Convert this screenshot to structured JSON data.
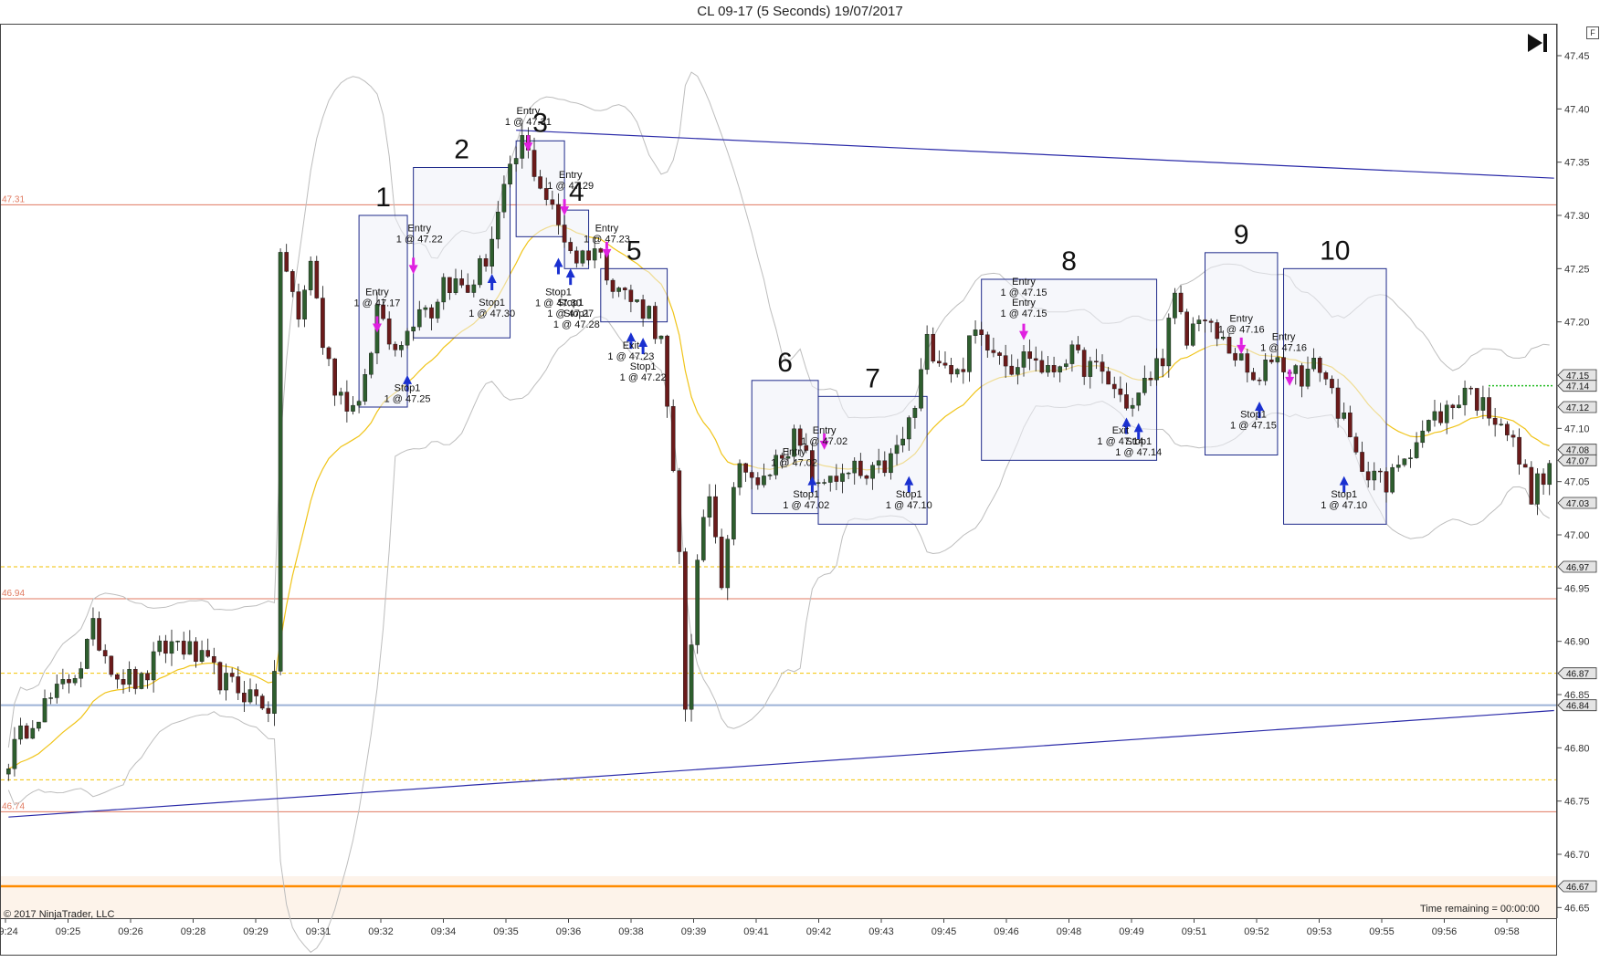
{
  "title": "CL 09-17 (5 Seconds)  19/07/2017",
  "copyright": "© 2017 NinjaTrader, LLC",
  "time_remaining": "Time remaining = 00:00:00",
  "corner_button": "F",
  "play_icon": "skip-to-end-icon",
  "colors": {
    "up_bar": "#2e5e2e",
    "down_bar": "#6b1a1a",
    "bollinger": "#bdbdbd",
    "ema": "#f0c419",
    "trendline": "#2a2aa8",
    "level_red": "#e07a60",
    "level_yellow": "#f2c200",
    "level_orange": "#ff8c00",
    "level_blue": "#9db2d6",
    "box_border": "#1e2a8a",
    "entry_arrow": "#e020e0",
    "exit_arrow": "#1a30d0"
  },
  "chart_data": {
    "type": "candlestick",
    "x_ticks": [
      "09:24",
      "09:25",
      "09:26",
      "09:28",
      "09:29",
      "09:31",
      "09:32",
      "09:34",
      "09:35",
      "09:36",
      "09:38",
      "09:39",
      "09:41",
      "09:42",
      "09:43",
      "09:45",
      "09:46",
      "09:48",
      "09:49",
      "09:51",
      "09:52",
      "09:53",
      "09:55",
      "09:56",
      "09:58"
    ],
    "y_ticks": [
      "46.65",
      "46.70",
      "46.75",
      "46.80",
      "46.85",
      "46.90",
      "46.95",
      "47.00",
      "47.05",
      "47.10",
      "47.15",
      "47.20",
      "47.25",
      "47.30",
      "47.35",
      "47.40",
      "47.45"
    ],
    "ylim": [
      46.64,
      47.48
    ],
    "left_level_labels": [
      "47.31",
      "46.94",
      "46.74"
    ],
    "right_price_tags": [
      "47.15",
      "47.14",
      "47.12",
      "47.08",
      "47.07",
      "47.03",
      "46.97",
      "46.87",
      "46.84",
      "46.67"
    ],
    "horizontal_levels": [
      {
        "price": 47.31,
        "style": "red"
      },
      {
        "price": 46.94,
        "style": "red"
      },
      {
        "price": 46.74,
        "style": "red"
      },
      {
        "price": 46.97,
        "style": "yellow-dash"
      },
      {
        "price": 46.87,
        "style": "yellow-dash"
      },
      {
        "price": 46.77,
        "style": "yellow-dash"
      },
      {
        "price": 46.84,
        "style": "blue"
      },
      {
        "price": 46.67,
        "style": "orange"
      }
    ],
    "trendlines": [
      {
        "t1": 84,
        "p1": 47.38,
        "t2": 255,
        "p2": 47.335
      },
      {
        "t1": 0,
        "p1": 46.735,
        "t2": 255,
        "p2": 46.835
      }
    ],
    "path_anchors": [
      [
        0,
        46.79
      ],
      [
        4,
        46.83
      ],
      [
        8,
        46.85
      ],
      [
        12,
        46.88
      ],
      [
        14,
        46.91
      ],
      [
        18,
        46.87
      ],
      [
        22,
        46.86
      ],
      [
        25,
        46.89
      ],
      [
        28,
        46.9
      ],
      [
        32,
        46.88
      ],
      [
        36,
        46.86
      ],
      [
        40,
        46.85
      ],
      [
        43,
        46.84
      ],
      [
        44,
        46.86
      ],
      [
        45,
        47.27
      ],
      [
        48,
        47.2
      ],
      [
        50,
        47.26
      ],
      [
        52,
        47.18
      ],
      [
        54,
        47.14
      ],
      [
        57,
        47.12
      ],
      [
        60,
        47.16
      ],
      [
        61,
        47.22
      ],
      [
        63,
        47.18
      ],
      [
        66,
        47.19
      ],
      [
        68,
        47.22
      ],
      [
        70,
        47.21
      ],
      [
        72,
        47.24
      ],
      [
        76,
        47.23
      ],
      [
        79,
        47.26
      ],
      [
        82,
        47.32
      ],
      [
        85,
        47.37
      ],
      [
        88,
        47.33
      ],
      [
        91,
        47.29
      ],
      [
        94,
        47.26
      ],
      [
        97,
        47.27
      ],
      [
        100,
        47.24
      ],
      [
        103,
        47.22
      ],
      [
        106,
        47.21
      ],
      [
        108,
        47.18
      ],
      [
        110,
        47.05
      ],
      [
        111,
        46.98
      ],
      [
        112,
        46.84
      ],
      [
        114,
        46.97
      ],
      [
        116,
        47.04
      ],
      [
        118,
        46.96
      ],
      [
        120,
        47.05
      ],
      [
        122,
        47.07
      ],
      [
        124,
        47.04
      ],
      [
        126,
        47.06
      ],
      [
        128,
        47.08
      ],
      [
        130,
        47.09
      ],
      [
        132,
        47.07
      ],
      [
        134,
        47.04
      ],
      [
        136,
        47.06
      ],
      [
        138,
        47.05
      ],
      [
        140,
        47.06
      ],
      [
        142,
        47.05
      ],
      [
        144,
        47.06
      ],
      [
        146,
        47.07
      ],
      [
        148,
        47.09
      ],
      [
        150,
        47.12
      ],
      [
        152,
        47.18
      ],
      [
        154,
        47.17
      ],
      [
        157,
        47.15
      ],
      [
        160,
        47.19
      ],
      [
        163,
        47.18
      ],
      [
        166,
        47.16
      ],
      [
        169,
        47.17
      ],
      [
        172,
        47.15
      ],
      [
        175,
        47.17
      ],
      [
        178,
        47.16
      ],
      [
        181,
        47.15
      ],
      [
        184,
        47.13
      ],
      [
        186,
        47.12
      ],
      [
        188,
        47.14
      ],
      [
        191,
        47.17
      ],
      [
        193,
        47.22
      ],
      [
        195,
        47.18
      ],
      [
        197,
        47.21
      ],
      [
        199,
        47.19
      ],
      [
        201,
        47.18
      ],
      [
        203,
        47.17
      ],
      [
        205,
        47.15
      ],
      [
        207,
        47.14
      ],
      [
        209,
        47.17
      ],
      [
        211,
        47.16
      ],
      [
        214,
        47.15
      ],
      [
        217,
        47.16
      ],
      [
        220,
        47.12
      ],
      [
        223,
        47.07
      ],
      [
        226,
        47.06
      ],
      [
        228,
        47.04
      ],
      [
        230,
        47.07
      ],
      [
        233,
        47.09
      ],
      [
        236,
        47.11
      ],
      [
        239,
        47.12
      ],
      [
        241,
        47.14
      ],
      [
        244,
        47.12
      ],
      [
        247,
        47.11
      ],
      [
        250,
        47.07
      ],
      [
        252,
        47.04
      ],
      [
        255,
        47.06
      ]
    ],
    "trade_boxes": [
      {
        "label": "1",
        "t1": 58,
        "t2": 66,
        "hi": 47.3,
        "lo": 47.12
      },
      {
        "label": "2",
        "t1": 67,
        "t2": 83,
        "hi": 47.345,
        "lo": 47.185
      },
      {
        "label": "3",
        "t1": 84,
        "t2": 92,
        "hi": 47.37,
        "lo": 47.28
      },
      {
        "label": "4",
        "t1": 92,
        "t2": 96,
        "hi": 47.305,
        "lo": 47.25
      },
      {
        "label": "5",
        "t1": 98,
        "t2": 109,
        "hi": 47.25,
        "lo": 47.2
      },
      {
        "label": "6",
        "t1": 123,
        "t2": 134,
        "hi": 47.145,
        "lo": 47.02
      },
      {
        "label": "7",
        "t1": 134,
        "t2": 152,
        "hi": 47.13,
        "lo": 47.01
      },
      {
        "label": "8",
        "t1": 161,
        "t2": 190,
        "hi": 47.24,
        "lo": 47.07
      },
      {
        "label": "9",
        "t1": 198,
        "t2": 210,
        "hi": 47.265,
        "lo": 47.075
      },
      {
        "label": "10",
        "t1": 211,
        "t2": 228,
        "hi": 47.25,
        "lo": 47.01
      }
    ],
    "trade_labels": [
      {
        "lines": [
          "Entry",
          "1 @ 47.17"
        ],
        "t": 61,
        "p": 47.225
      },
      {
        "lines": [
          "Entry",
          "1 @ 47.22"
        ],
        "t": 68,
        "p": 47.285
      },
      {
        "lines": [
          "Stop1",
          "1 @ 47.25"
        ],
        "t": 66,
        "p": 47.135
      },
      {
        "lines": [
          "Stop1",
          "1 @ 47.30"
        ],
        "t": 80,
        "p": 47.215
      },
      {
        "lines": [
          "Entry",
          "1 @ 47.31"
        ],
        "t": 86,
        "p": 47.395
      },
      {
        "lines": [
          "Entry",
          "1 @ 47.29"
        ],
        "t": 93,
        "p": 47.335
      },
      {
        "lines": [
          "Entry",
          "1 @ 47.23"
        ],
        "t": 99,
        "p": 47.285
      },
      {
        "lines": [
          "Stop1",
          "1 @ 47.30"
        ],
        "t": 91,
        "p": 47.225
      },
      {
        "lines": [
          "Stop1",
          "1 @ 47.27"
        ],
        "t": 93,
        "p": 47.215
      },
      {
        "lines": [
          "Stop1",
          "1 @ 47.28"
        ],
        "t": 94,
        "p": 47.205
      },
      {
        "lines": [
          "Exit",
          "1 @ 47.23"
        ],
        "t": 103,
        "p": 47.175
      },
      {
        "lines": [
          "Stop1",
          "1 @ 47.22"
        ],
        "t": 105,
        "p": 47.155
      },
      {
        "lines": [
          "Entry",
          "1 @ 47.02"
        ],
        "t": 135,
        "p": 47.095
      },
      {
        "lines": [
          "Entry",
          "1 @ 47.02"
        ],
        "t": 130,
        "p": 47.075
      },
      {
        "lines": [
          "Stop1",
          "1 @ 47.02"
        ],
        "t": 132,
        "p": 47.035
      },
      {
        "lines": [
          "Stop1",
          "1 @ 47.10"
        ],
        "t": 149,
        "p": 47.035
      },
      {
        "lines": [
          "Entry",
          "1 @ 47.15"
        ],
        "t": 168,
        "p": 47.235
      },
      {
        "lines": [
          "Entry",
          "1 @ 47.15"
        ],
        "t": 168,
        "p": 47.215
      },
      {
        "lines": [
          "Exit",
          "1 @ 47.14"
        ],
        "t": 184,
        "p": 47.095
      },
      {
        "lines": [
          "Stop1",
          "1 @ 47.14"
        ],
        "t": 187,
        "p": 47.085
      },
      {
        "lines": [
          "Entry",
          "1 @ 47.16"
        ],
        "t": 204,
        "p": 47.2
      },
      {
        "lines": [
          "Stop1",
          "1 @ 47.15"
        ],
        "t": 206,
        "p": 47.11
      },
      {
        "lines": [
          "Entry",
          "1 @ 47.16"
        ],
        "t": 211,
        "p": 47.183
      },
      {
        "lines": [
          "Stop1",
          "1 @ 47.10"
        ],
        "t": 221,
        "p": 47.035
      }
    ],
    "entry_arrows": [
      [
        61,
        47.195
      ],
      [
        67,
        47.25
      ],
      [
        86,
        47.365
      ],
      [
        92,
        47.305
      ],
      [
        99,
        47.265
      ],
      [
        135,
        47.085
      ],
      [
        168,
        47.188
      ],
      [
        204,
        47.175
      ],
      [
        212,
        47.145
      ]
    ],
    "exit_arrows": [
      [
        66,
        47.145
      ],
      [
        80,
        47.24
      ],
      [
        91,
        47.255
      ],
      [
        93,
        47.245
      ],
      [
        103,
        47.185
      ],
      [
        105,
        47.18
      ],
      [
        133,
        47.05
      ],
      [
        149,
        47.05
      ],
      [
        185,
        47.105
      ],
      [
        187,
        47.1
      ],
      [
        207,
        47.12
      ],
      [
        221,
        47.05
      ]
    ]
  }
}
